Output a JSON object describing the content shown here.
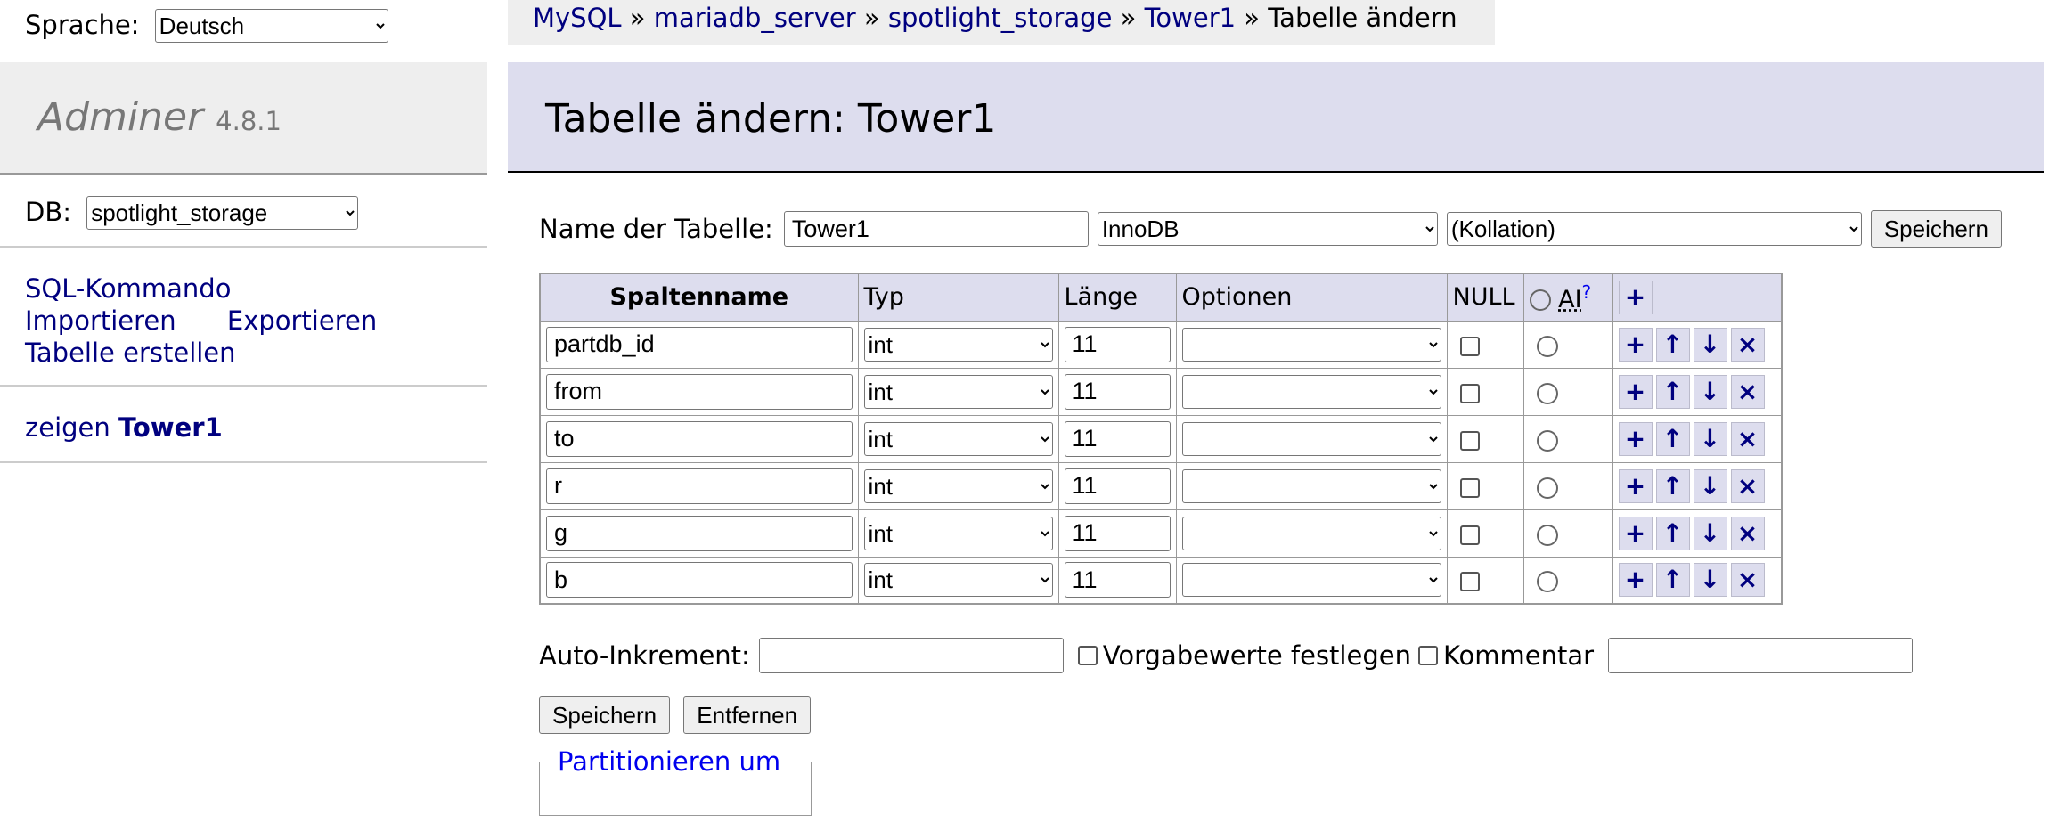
{
  "language": {
    "label": "Sprache:",
    "selected": "Deutsch"
  },
  "brand": {
    "name": "Adminer",
    "version": "4.8.1"
  },
  "db": {
    "label": "DB:",
    "selected": "spotlight_storage"
  },
  "menu": {
    "sql": "SQL-Kommando",
    "import": "Importieren",
    "export": "Exportieren",
    "create_table": "Tabelle erstellen"
  },
  "tables": {
    "show": "zeigen",
    "name": "Tower1"
  },
  "breadcrumb": {
    "items": [
      "MySQL",
      "mariadb_server",
      "spotlight_storage",
      "Tower1"
    ],
    "sep": "»",
    "current": "Tabelle ändern"
  },
  "heading": "Tabelle ändern: Tower1",
  "form": {
    "name_label": "Name der Tabelle:",
    "name_value": "Tower1",
    "engine": "InnoDB",
    "collation": "(Kollation)",
    "save": "Speichern"
  },
  "columns": {
    "headers": {
      "name": "Spaltenname",
      "type": "Typ",
      "length": "Länge",
      "options": "Optionen",
      "null": "NULL",
      "ai": "AI",
      "ai_help": "?"
    },
    "rows": [
      {
        "name": "partdb_id",
        "type": "int",
        "length": "11",
        "options": ""
      },
      {
        "name": "from",
        "type": "int",
        "length": "11",
        "options": ""
      },
      {
        "name": "to",
        "type": "int",
        "length": "11",
        "options": ""
      },
      {
        "name": "r",
        "type": "int",
        "length": "11",
        "options": ""
      },
      {
        "name": "g",
        "type": "int",
        "length": "11",
        "options": ""
      },
      {
        "name": "b",
        "type": "int",
        "length": "11",
        "options": ""
      }
    ],
    "icons": {
      "add": "+",
      "up": "↑",
      "down": "↓",
      "remove": "×"
    }
  },
  "auto_increment": {
    "label": "Auto-Inkrement:",
    "value": ""
  },
  "defaults_label": "Vorgabewerte festlegen",
  "comment": {
    "label": "Kommentar",
    "value": ""
  },
  "buttons": {
    "save": "Speichern",
    "remove": "Entfernen"
  },
  "partition": {
    "legend": "Partitionieren um"
  },
  "colors": {
    "link": "#00007f",
    "header_bg": "#dde",
    "panel_bg": "#eee"
  }
}
